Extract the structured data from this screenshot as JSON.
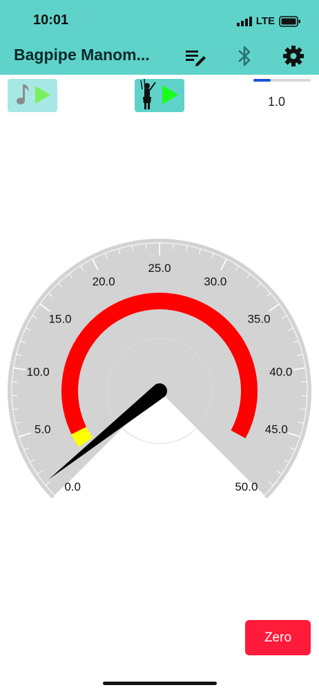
{
  "status_bar": {
    "time": "10:01",
    "network": "LTE"
  },
  "app_bar": {
    "title": "Bagpipe Manom...",
    "icons": [
      "edit-list-icon",
      "bluetooth-icon",
      "gear-icon"
    ]
  },
  "toolbar": {
    "tone_play": {
      "icons": [
        "music-note-icon",
        "play-icon"
      ]
    },
    "piper_play": {
      "icons": [
        "piper-icon",
        "play-icon"
      ]
    },
    "slider": {
      "value": 0.3,
      "value_label": "1.0"
    }
  },
  "gauge": {
    "min": 0,
    "max": 50,
    "needle_value": 1.2,
    "tick_labels": [
      "0.0",
      "5.0",
      "10.0",
      "15.0",
      "20.0",
      "25.0",
      "30.0",
      "35.0",
      "40.0",
      "45.0",
      "50.0"
    ],
    "red_band": [
      3.5,
      47
    ],
    "yellow_band": [
      1.9,
      3.5
    ],
    "colors": {
      "face": "#d3d3d3",
      "red": "#ff0000",
      "yellow": "#ffff00",
      "needle": "#000000",
      "ticks": "#ffffff"
    }
  },
  "zero_button": {
    "label": "Zero"
  }
}
